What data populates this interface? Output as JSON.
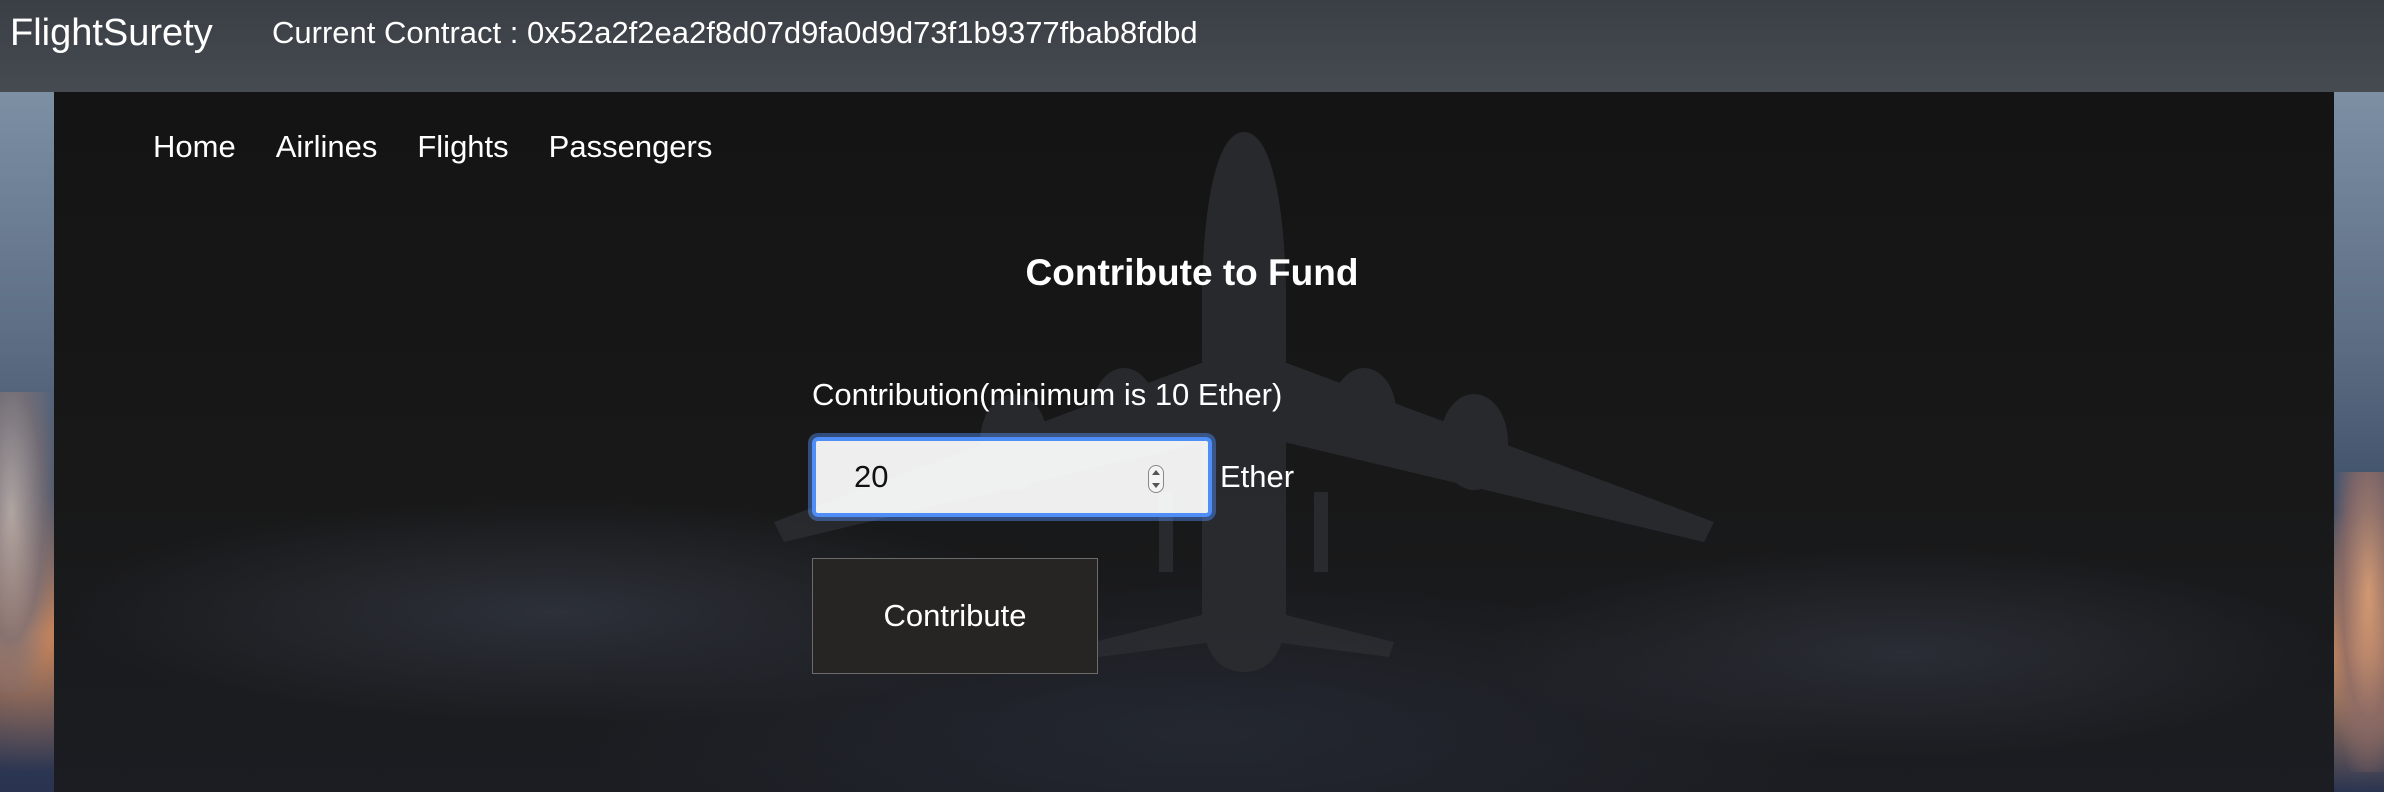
{
  "header": {
    "brand": "FlightSurety",
    "contract_text": "Current Contract : 0x52a2f2ea2f8d07d9fa0d9d73f1b9377fbab8fdbd"
  },
  "nav": {
    "items": [
      {
        "label": "Home"
      },
      {
        "label": "Airlines"
      },
      {
        "label": "Flights"
      },
      {
        "label": "Passengers"
      }
    ]
  },
  "form": {
    "title": "Contribute to Fund",
    "contribution_label": "Contribution(minimum is 10 Ether)",
    "amount_value": "20",
    "unit": "Ether",
    "submit_label": "Contribute"
  },
  "colors": {
    "topbar": "#41464c",
    "focus_ring": "#4f8ef7",
    "panel": "#161616"
  }
}
